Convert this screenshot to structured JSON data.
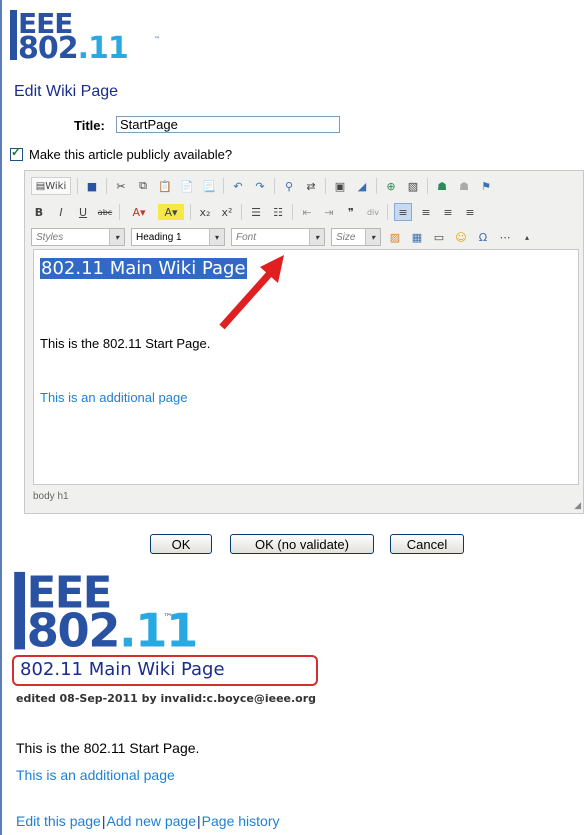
{
  "logo_top": {
    "line1": "EEE",
    "line2_a": "802",
    "line2_b": ".11",
    "tm": "™"
  },
  "editor_section": {
    "heading": "Edit Wiki Page",
    "title_label": "Title:",
    "title_value": "StartPage",
    "public_label": "Make this article publicly available?",
    "public_checked": true
  },
  "toolbar": {
    "row1": [
      "wiki-source",
      "save",
      "cut",
      "copy",
      "paste",
      "paste-text",
      "paste-word",
      "undo",
      "redo",
      "find",
      "replace",
      "select-all",
      "remove-format",
      "anchor",
      "image",
      "flash",
      "table",
      "link",
      "unlink",
      "flag"
    ],
    "wiki_label": "Wiki",
    "row2": [
      "bold",
      "italic",
      "underline",
      "strike",
      "text-color",
      "bg-color",
      "subscript",
      "superscript",
      "ordered-list",
      "unordered-list",
      "outdent",
      "indent",
      "blockquote",
      "div",
      "align-left",
      "align-center",
      "align-right",
      "justify"
    ],
    "styles": "Styles",
    "format": "Heading 1",
    "font": "Font",
    "size": "Size"
  },
  "editor_content": {
    "heading": "802.11 Main Wiki Page",
    "paragraph": "This is the 802.11 Start Page.",
    "link": "This is an additional page",
    "status_path": "body  h1"
  },
  "buttons": {
    "ok": "OK",
    "ok_no_validate": "OK (no validate)",
    "cancel": "Cancel"
  },
  "preview": {
    "title": "802.11 Main Wiki Page",
    "edited": "edited 08-Sep-2011 by invalid:c.boyce@ieee.org",
    "paragraph": "This is the 802.11 Start Page.",
    "link": "This is an additional page",
    "footer": {
      "edit": "Edit this page",
      "sep": "|",
      "add": "Add new page",
      "history": "Page history"
    }
  },
  "colors": {
    "heading_blue": "#1a2c8c",
    "link_blue": "#1e7fd8",
    "highlight": "#d32f2f",
    "selection": "#316ac5"
  }
}
